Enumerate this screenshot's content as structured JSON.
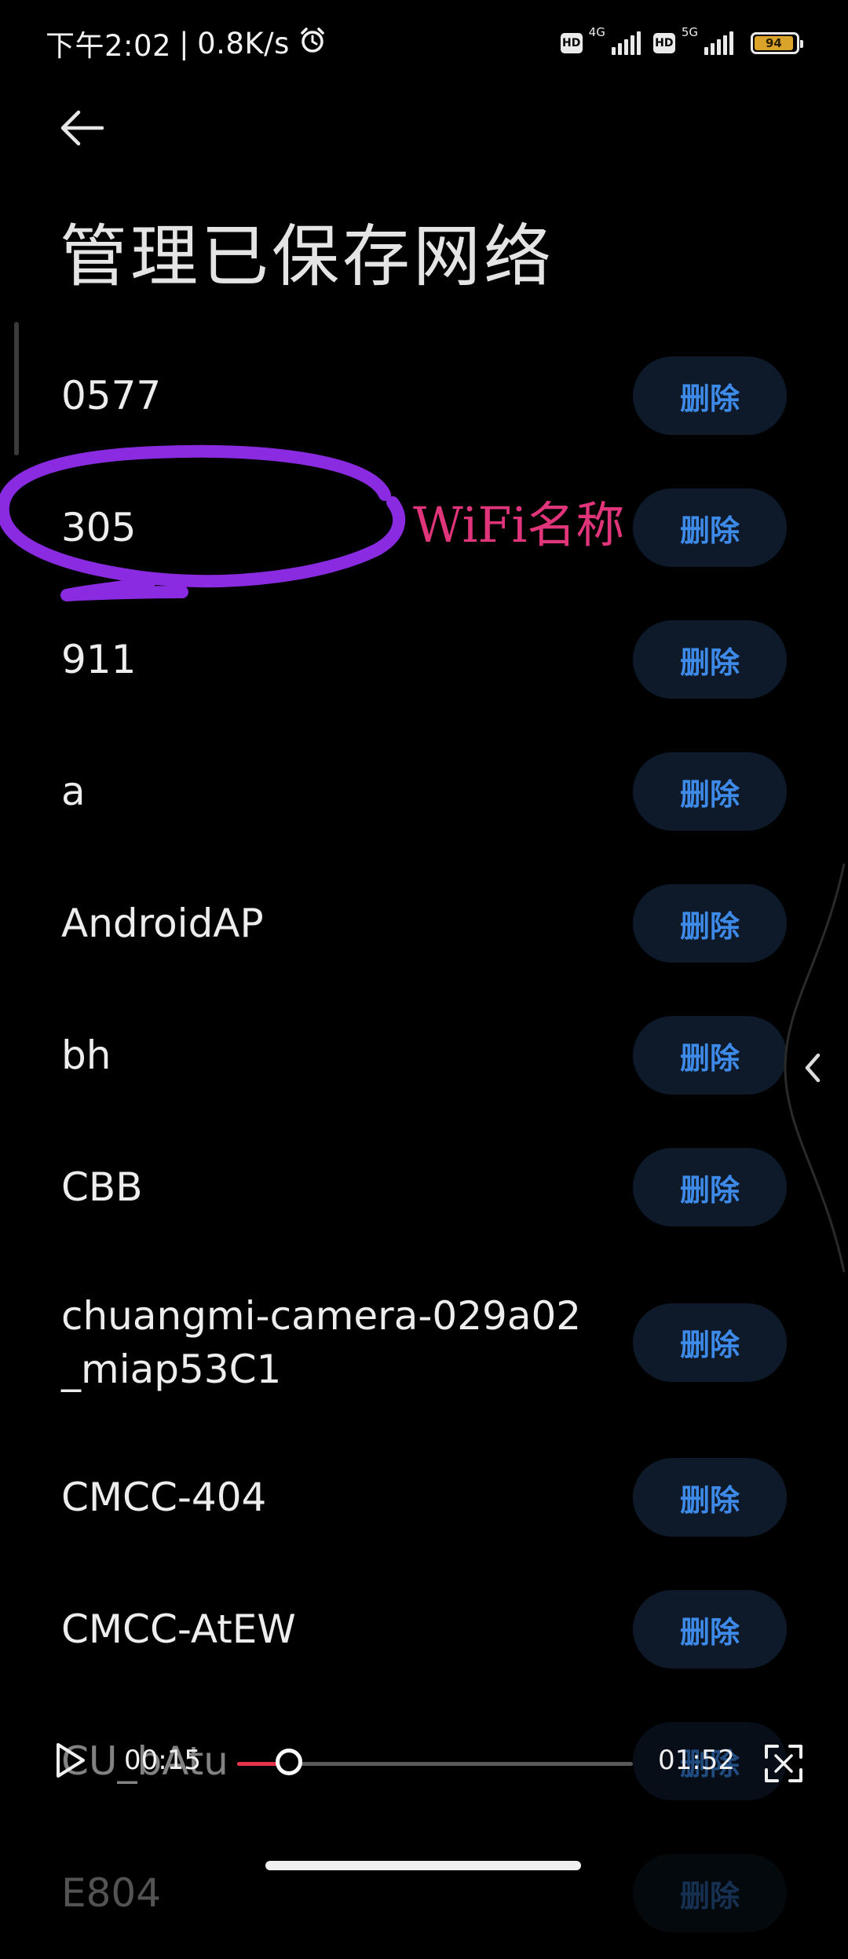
{
  "status_bar": {
    "time": "下午2:02",
    "separator": "|",
    "speed": "0.8K/s",
    "sim1": {
      "hd": "HD",
      "type": "4G"
    },
    "sim2": {
      "hd": "HD",
      "type": "5G"
    },
    "battery": "94",
    "battery_level_fraction": 0.94,
    "battery_color": "#d9a429"
  },
  "header": {
    "title": "管理已保存网络"
  },
  "networks": [
    {
      "name": "0577",
      "action": "删除"
    },
    {
      "name": "305",
      "action": "删除"
    },
    {
      "name": "911",
      "action": "删除"
    },
    {
      "name": "a",
      "action": "删除"
    },
    {
      "name": "AndroidAP",
      "action": "删除"
    },
    {
      "name": "bh",
      "action": "删除"
    },
    {
      "name": "CBB",
      "action": "删除"
    },
    {
      "name": "chuangmi-camera-029a02_miap53C1",
      "action": "删除"
    },
    {
      "name": "CMCC-404",
      "action": "删除"
    },
    {
      "name": "CMCC-AtEW",
      "action": "删除"
    },
    {
      "name": "CU_bAtu",
      "action": "删除"
    },
    {
      "name": "E804",
      "action": "删除"
    }
  ],
  "annotation": {
    "label": "WiFi名称",
    "color": "#e0357a",
    "circle_color": "#8a2be2"
  },
  "player": {
    "current_time": "00:15",
    "total_time": "01:52",
    "progress_fraction": 0.13,
    "progress_color": "#e8344a"
  },
  "accent_color": "#3d8ae8"
}
